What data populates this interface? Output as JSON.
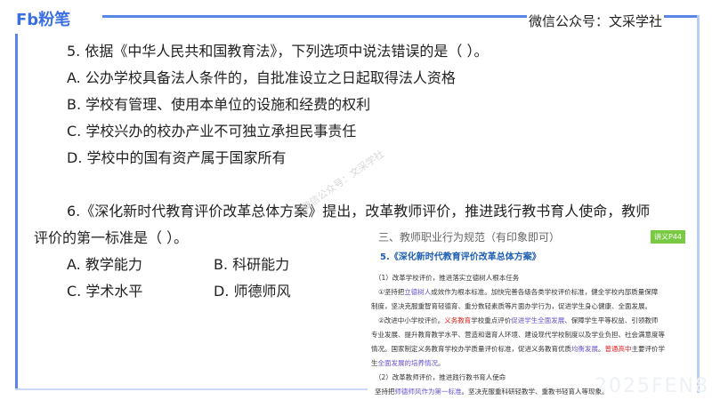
{
  "header": {
    "logo": "Fb粉笔",
    "wechat": "微信公众号：文采学社"
  },
  "q5": {
    "stem": "5. 依据《中华人民共和国教育法》，下列选项中说法错误的是（ ）。",
    "options": [
      "A. 公办学校具备法人条件的，自批准设立之日起取得法人资格",
      "B. 学校有管理、使用本单位的设施和经费的权利",
      "C. 学校兴办的校办产业不可独立承担民事责任",
      "D. 学校中的国有资产属于国家所有"
    ]
  },
  "q6": {
    "stem1": "6.《深化新时代教育评价改革总体方案》提出，改革教师评价，推进践行教书育人使命，教师",
    "stem2": "评价的第一标准是（ ）。",
    "options": [
      "A. 教学能力",
      "B. 科研能力",
      "C. 学术水平",
      "D. 师德师风"
    ]
  },
  "watermark": "微信公众号：文采学社",
  "panel": {
    "heading": "三、教师职业行为规范（有印象即可）",
    "badge": "讲义P44",
    "subtitle": "5.《深化新时代教育评价改革总体方案》",
    "l1": "（1）改革学校评价，推进落实立德树人根本任务",
    "l2a": "①坚持把",
    "l2b": "立德树人",
    "l2c": "成效作为根本标准。加快完善各级各类学校评价标准，健全学校内部质量保障",
    "l3": "制度，坚决克服重智育轻德育、重分数轻素质等片面办学行为，促进学生身心健康、全面发展。",
    "l4a": "②改进中小学校评价。",
    "l4b": "义务教育",
    "l4c": "学校重点评价",
    "l4d": "促进学生全面发展",
    "l4e": "、保障学生平等权益、引领教师",
    "l5": "专业发展、提升教育教学水平、营造和谐育人环境、建设现代学校制度以及学业负担、社会满意度等",
    "l6a": "情况。国家制定义务教育学校办学质量评价标准，促进义务教育优质",
    "l6b": "均衡发展",
    "l6c": "。",
    "l6d": "普通高中",
    "l6e": "主要评价学",
    "l7a": "生",
    "l7b": "全面发展的培养情况",
    "l7c": "。",
    "l8": "（2）改革教师评价，推进践行教书育人使命",
    "l9a": "坚持把",
    "l9b": "师德师风作为第一标准",
    "l9c": "。坚决克服重科研轻教学、重教书轻育人等现象。",
    "wm": "2025FEN8"
  }
}
